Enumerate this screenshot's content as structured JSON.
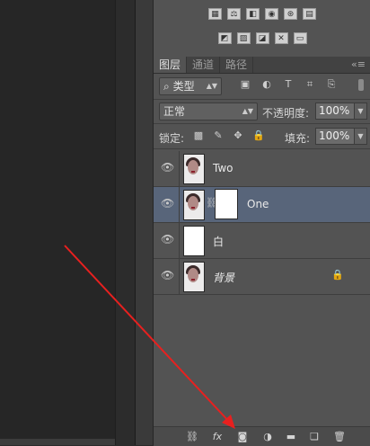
{
  "tabs": [
    {
      "label": "图层",
      "active": true
    },
    {
      "label": "通道",
      "active": false
    },
    {
      "label": "路径",
      "active": false
    }
  ],
  "panel_menu_icon": "panel-menu-icon",
  "filter": {
    "search_glyph": "⌕",
    "kind_label": "类型"
  },
  "blend": {
    "mode": "正常",
    "opacity_label": "不透明度:",
    "opacity_value": "100%"
  },
  "lock": {
    "label": "锁定:",
    "fill_label": "填充:",
    "fill_value": "100%"
  },
  "layers": [
    {
      "name": "Two",
      "thumb": "portrait",
      "visible": true,
      "selected": false
    },
    {
      "name": "One",
      "thumb": "portrait",
      "visible": true,
      "selected": true,
      "mask": true
    },
    {
      "name": "白",
      "thumb": "white",
      "visible": true,
      "selected": false
    },
    {
      "name": "背景",
      "thumb": "portrait",
      "visible": true,
      "selected": false,
      "locked": true,
      "italic": true
    }
  ],
  "bottom_icons": [
    "link-layers-icon",
    "fx-icon",
    "add-mask-icon",
    "adjustment-layer-icon",
    "new-group-icon",
    "new-layer-icon",
    "delete-icon"
  ],
  "fx_label": "fx",
  "colors": {
    "panel_bg": "#535353",
    "selected_row": "#58657a",
    "arrow": "#e8201f"
  }
}
